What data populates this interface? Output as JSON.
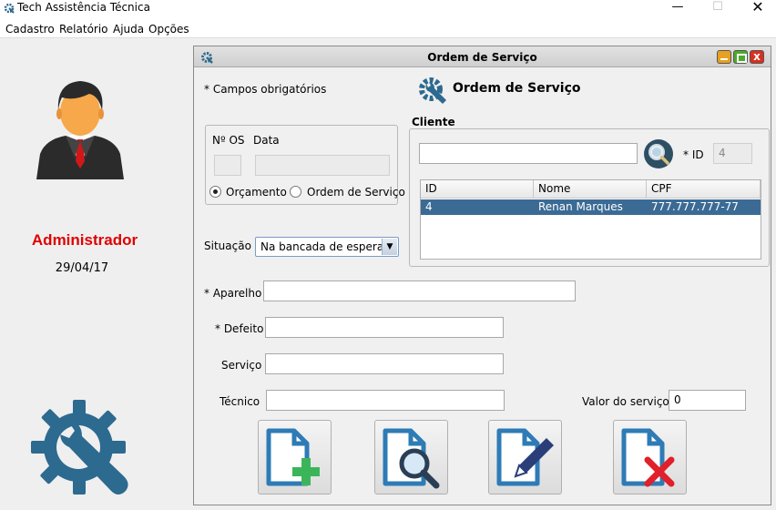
{
  "window": {
    "title": "Tech Assistência Técnica",
    "controls": {
      "minimize": "—",
      "maximize": "☐",
      "close": "✕"
    }
  },
  "menu": [
    "Cadastro",
    "Relatório",
    "Ajuda",
    "Opções"
  ],
  "sidebar": {
    "user_name": "Administrador",
    "date": "29/04/17",
    "name_color": "#e00000"
  },
  "frame": {
    "title": "Ordem de Serviço",
    "required_note": "* Campos obrigatórios",
    "header_title": "Ordem de Serviço",
    "os_panel": {
      "os_number_label": "Nº OS",
      "date_label": "Data",
      "os_number_value": "",
      "date_value": "",
      "radio_orcamento": "Orçamento",
      "radio_ordem": "Ordem de Serviço",
      "selected": "Orçamento"
    },
    "situacao_label": "Situação",
    "situacao_value": "Na bancada de espera",
    "cliente": {
      "label": "Cliente",
      "search_value": "",
      "id_label": "* ID",
      "id_value": "4",
      "columns": [
        "ID",
        "Nome",
        "CPF"
      ],
      "rows": [
        {
          "id": "4",
          "nome": "Renan Marques",
          "cpf": "777.777.777-77"
        }
      ]
    },
    "fields": {
      "aparelho_label": "* Aparelho",
      "defeito_label": "* Defeito",
      "servico_label": "Serviço",
      "tecnico_label": "Técnico",
      "valor_label": "Valor do serviço",
      "aparelho_value": "",
      "defeito_value": "",
      "servico_value": "",
      "tecnico_value": "",
      "valor_value": "0"
    },
    "actions": [
      "add-document",
      "search-document",
      "edit-document",
      "delete-document"
    ],
    "close_glyph": "x"
  },
  "colors": {
    "selection": "#3b6b95",
    "icon_blue": "#2e7bb6",
    "gear_blue": "#2d6a8f",
    "add_green": "#3cb55a",
    "delete_red": "#e0202a"
  }
}
